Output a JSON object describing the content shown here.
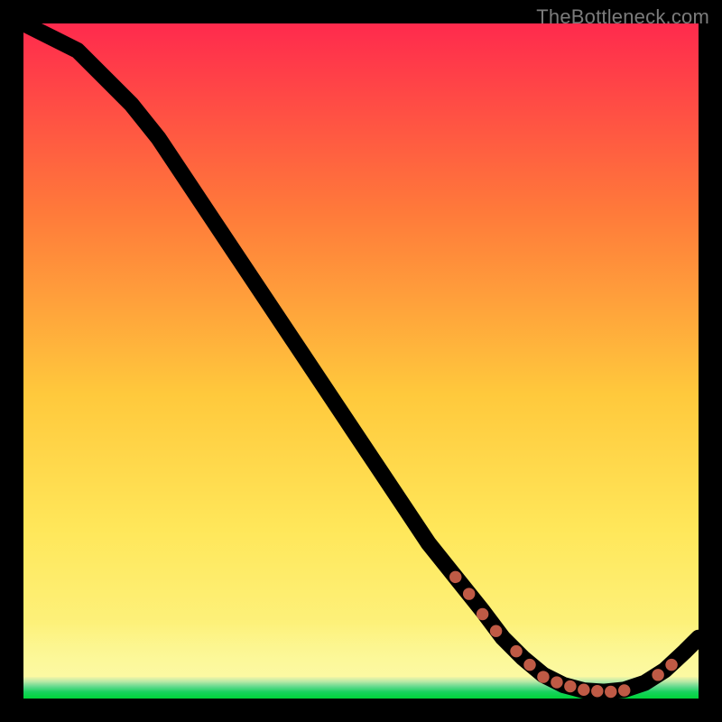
{
  "watermark": "TheBottleneck.com",
  "chart_data": {
    "type": "line",
    "title": "",
    "xlabel": "",
    "ylabel": "",
    "xlim": [
      0,
      100
    ],
    "ylim": [
      0,
      100
    ],
    "series": [
      {
        "name": "bottleneck-curve",
        "x": [
          0,
          4,
          8,
          12,
          16,
          20,
          24,
          28,
          32,
          36,
          40,
          44,
          48,
          52,
          56,
          60,
          64,
          68,
          71,
          74,
          77,
          80,
          83,
          86,
          89,
          92,
          95,
          98,
          100
        ],
        "y": [
          100,
          98,
          96,
          92,
          88,
          83,
          77,
          71,
          65,
          59,
          53,
          47,
          41,
          35,
          29,
          23,
          18,
          13,
          9,
          6,
          3.5,
          2,
          1.2,
          1,
          1.3,
          2.3,
          4.2,
          7,
          9
        ]
      }
    ],
    "markers": {
      "name": "highlight-points",
      "color": "#d9674f",
      "x": [
        64,
        66,
        68,
        70,
        73,
        75,
        77,
        79,
        81,
        83,
        85,
        87,
        89,
        94,
        96
      ],
      "y": [
        18,
        15.5,
        12.5,
        10,
        7,
        5,
        3.2,
        2.4,
        1.8,
        1.3,
        1.1,
        1.0,
        1.2,
        3.5,
        5
      ]
    },
    "background_gradient": {
      "top": "#ff2a4d",
      "mid_upper": "#ff7a3a",
      "mid": "#ffc93c",
      "mid_lower": "#ffe75a",
      "low": "#fcf68a",
      "bottom_band": "#00d43a"
    }
  }
}
